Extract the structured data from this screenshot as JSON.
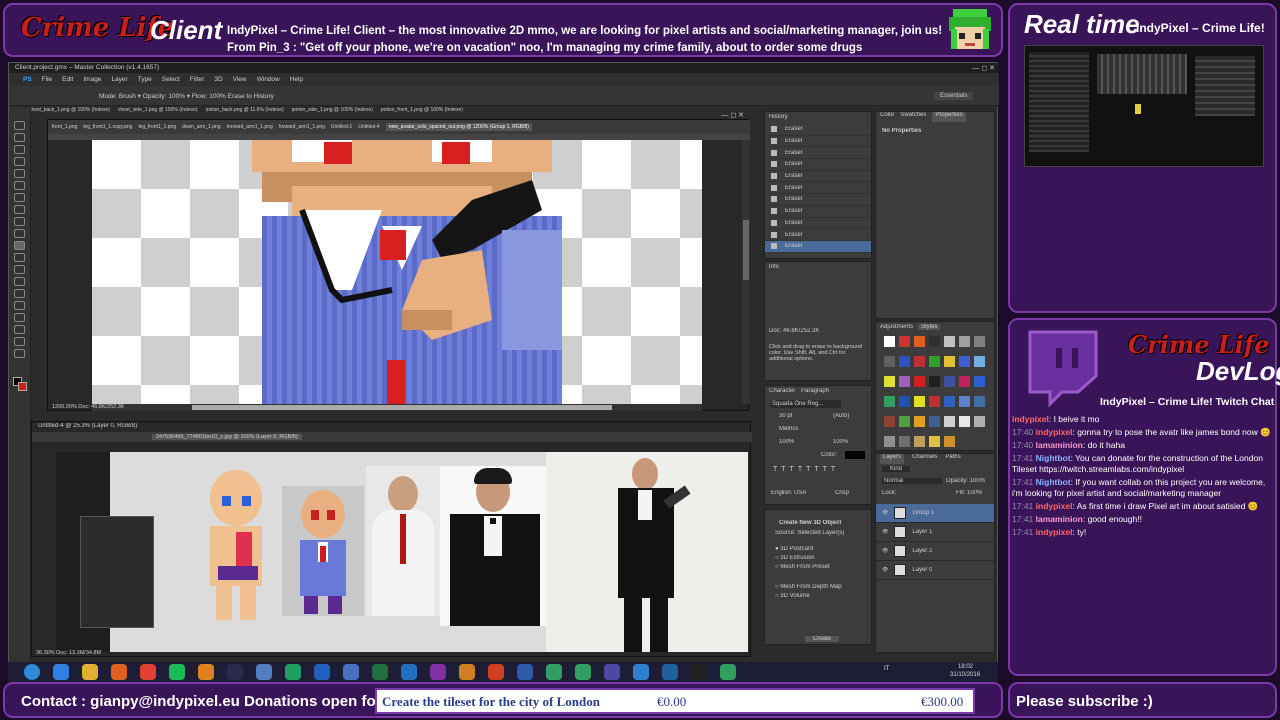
{
  "stream": {
    "client_title": "Client",
    "client_line1": "IndyPixel – Crime Life!  Client – the most innovative 2D mmo, we are looking for pixel artists and social/marketing manager, join us!",
    "client_line2": "From Pin_3 : \"Get off your phone, we're on vacation\" noo, I'm managing my crime family, about to order some drugs",
    "realtime_title": "Real time",
    "realtime_subtitle": "IndyPixel – Crime Life!",
    "logo_text": "Crime Life",
    "devlog_title": "DevLog",
    "devlog_subtitle": "IndyPixel – Crime Life!  Twitch Chat",
    "contact": "Contact : gianpy@indypixel.eu  Donations open for :",
    "goal_label": "Create the tileset for the city of London",
    "goal_current": "€0.00",
    "goal_target": "€300.00",
    "subscribe": "Please subscribe :)"
  },
  "chat": [
    {
      "time": "",
      "user": "indypixel",
      "text": "I beive it mo",
      "cls": "chat-user"
    },
    {
      "time": "17:40",
      "user": "indypixel",
      "text": "gonna try to pose the avatr like james bond now 😊",
      "cls": "chat-user"
    },
    {
      "time": "17:40",
      "user": "lamaminion",
      "text": "do it haha",
      "cls": "chat-user2"
    },
    {
      "time": "17:41",
      "user": "Nightbot",
      "text": "You can donate for the construction of the London Tileset https://twitch.streamlabs.com/indypixel",
      "cls": "chat-user3"
    },
    {
      "time": "17:41",
      "user": "Nightbot",
      "text": "If you want collab on this project you are welcome, i'm looking for pixel artist and social/marketing manager",
      "cls": "chat-user3"
    },
    {
      "time": "17:41",
      "user": "indypixel",
      "text": "As first time i draw Pixel art im about satisied 😊",
      "cls": "chat-user"
    },
    {
      "time": "17:41",
      "user": "lamaminion",
      "text": "good enough!!",
      "cls": "chat-user2"
    },
    {
      "time": "17:41",
      "user": "indypixel",
      "text": "ty!",
      "cls": "chat-user"
    }
  ],
  "ps": {
    "window_title": "Client.project.gmx – Master Collection (v1.4.1657)",
    "menu": [
      "PS",
      "File",
      "Edit",
      "Image",
      "Layer",
      "Type",
      "Select",
      "Filter",
      "3D",
      "View",
      "Window",
      "Help"
    ],
    "options": "Mode: Brush  ▾   Opacity: 100%  ▾   Flow: 100%   Erase to History",
    "essentials": "Essentials",
    "tabs_top": [
      "chest_back_1.png @ 100% (Indexe)",
      "chest_side_1.png @ 100% (Indexe)",
      "potion_back.png @ 11.6% (Indexe)",
      "potion_side_1.png @ 100% (Indexe)",
      "potion_front_1.png @ 100% (Indexe)"
    ],
    "tabs_doc": [
      "front_1.png",
      "leg_front1_1.copy.png",
      "leg_front1_1.png",
      "down_arm_1.png",
      "forward_arm1_1.png",
      "forward_arm1_1.png",
      "Untitled-1",
      "Untitled-4",
      "new_avatar_solo_spaced_out.png @ 1200% (Group 1, RGB/8)"
    ],
    "doc_status": "1200.00%   Doc: 46.8K/252.3K",
    "win2_title": "Untitled-4 @ 25.3% (Layer 0, RGB/8)",
    "win2_tab": "247595485_774801be10_z.jpg @ 100% (Layer 0, RGB/8)",
    "win2_status": "36.30%   Doc: 13.3M/34.8M",
    "history_title": "History",
    "history_items": [
      "Eraser",
      "Eraser",
      "Eraser",
      "Eraser",
      "Eraser",
      "Eraser",
      "Eraser",
      "Eraser",
      "Eraser",
      "Eraser",
      "Eraser"
    ],
    "properties_tabs": [
      "Color",
      "Swatches",
      "Properties"
    ],
    "no_properties": "No Properties",
    "info_title": "Info",
    "info_text": "Doc: 46.8K/252.3K",
    "info_hint": "Click and drag to erase to background color. Use Shift, Alt, and Ctrl for additional options.",
    "adjust_tabs": [
      "Adjustments",
      "Styles"
    ],
    "character_tabs": [
      "Character",
      "Paragraph"
    ],
    "font_name": "Squada One Reg...",
    "font_size": "30 pt",
    "leading": "(Auto)",
    "tracking": "Metrics",
    "scale1": "100%",
    "scale2": "100%",
    "color_label": "Color:",
    "lang": "English: USA",
    "aa": "Crisp",
    "create3d_title": "Create New 3D Object",
    "create3d_source": "Source:  Selected Layer(s)",
    "create3d_options": [
      "3D Postcard",
      "3D Extrusion",
      "Mesh From Preset",
      "Mesh From Depth Map",
      "3D Volume"
    ],
    "create_button": "Create",
    "layers_tabs": [
      "Layers",
      "Channels",
      "Paths"
    ],
    "layer_kind": "Kind",
    "blend_mode": "Normal",
    "opacity": "Opacity: 100%",
    "lock": "Lock:",
    "fill": "Fill: 100%",
    "layers": [
      "Group 1",
      "Layer 1",
      "Layer 2",
      "Layer 0"
    ]
  },
  "taskbar": {
    "time": "18:02",
    "date": "31/10/2016",
    "lang": "IT",
    "apps": [
      "windows-start",
      "ie",
      "explorer",
      "firefox",
      "chrome",
      "spotify",
      "vlc",
      "steam",
      "notepad",
      "app-c",
      "photoshop",
      "chat",
      "excel",
      "outlook",
      "onenote",
      "lock",
      "powerpoint",
      "word",
      "app-x",
      "app-a",
      "app-b",
      "stream",
      "hotspot",
      "cmd",
      "app-v"
    ]
  },
  "colors": {
    "frame": "#3a1458",
    "frame_border": "#7a3aa8",
    "ps_bg": "#2b2b2b",
    "accent_red": "#c81e1e"
  }
}
